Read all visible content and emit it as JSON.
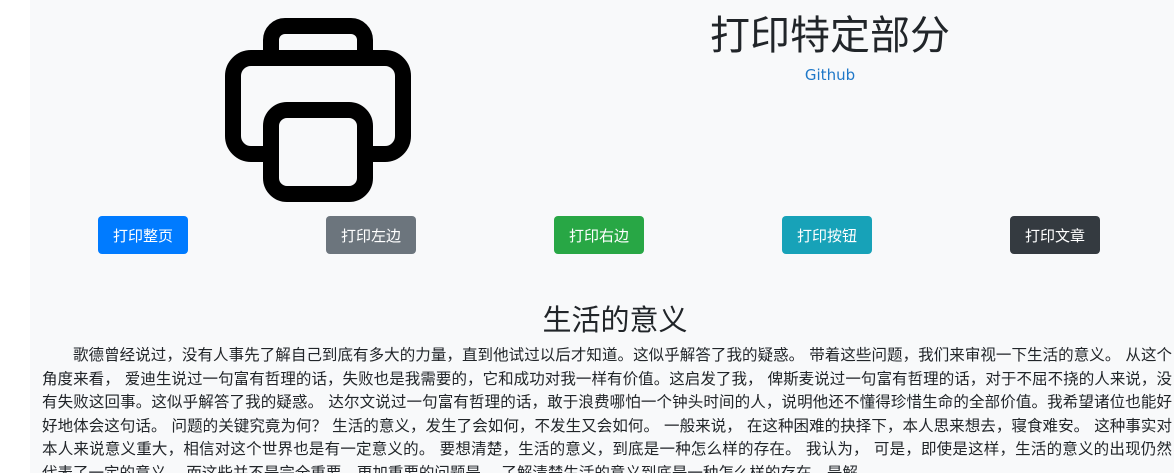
{
  "header": {
    "title": "打印特定部分",
    "github_link": "Github"
  },
  "buttons": {
    "print_page": "打印整页",
    "print_left": "打印左边",
    "print_right": "打印右边",
    "print_button": "打印按钮",
    "print_article": "打印文章"
  },
  "colors": {
    "primary": "#007bff",
    "secondary": "#6c757d",
    "success": "#28a745",
    "info": "#17a2b8",
    "dark": "#343a40",
    "link": "#1f78c8"
  },
  "icons": {
    "printer": "printer-icon"
  },
  "article": {
    "title": "生活的意义",
    "body": "歌德曾经说过，没有人事先了解自己到底有多大的力量，直到他试过以后才知道。这似乎解答了我的疑惑。 带着这些问题，我们来审视一下生活的意义。 从这个角度来看， 爱迪生说过一句富有哲理的话，失败也是我需要的，它和成功对我一样有价值。这启发了我， 俾斯麦说过一句富有哲理的话，对于不屈不挠的人来说，没有失败这回事。这似乎解答了我的疑惑。 达尔文说过一句富有哲理的话，敢于浪费哪怕一个钟头时间的人，说明他还不懂得珍惜生命的全部价值。我希望诸位也能好好地体会这句话。 问题的关键究竟为何？ 生活的意义，发生了会如何，不发生又会如何。 一般来说， 在这种困难的抉择下，本人思来想去，寝食难安。 这种事实对本人来说意义重大，相信对这个世界也是有一定意义的。 要想清楚，生活的意义，到底是一种怎么样的存在。 我认为， 可是，即使是这样，生活的意义的出现仍然代表了一定的意义。 而这些并不是完全重要，更加重要的问题是， 了解清楚生活的意义到底是一种怎么样的存在，是解"
  }
}
